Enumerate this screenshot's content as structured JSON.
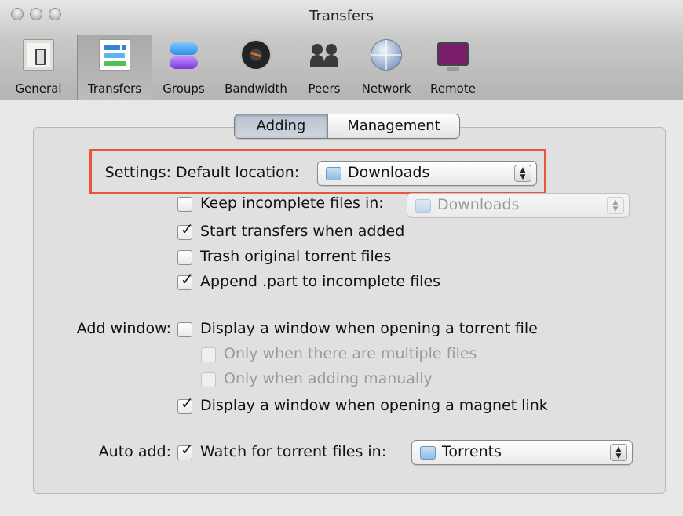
{
  "window": {
    "title": "Transfers"
  },
  "toolbar": {
    "items": [
      {
        "label": "General"
      },
      {
        "label": "Transfers"
      },
      {
        "label": "Groups"
      },
      {
        "label": "Bandwidth"
      },
      {
        "label": "Peers"
      },
      {
        "label": "Network"
      },
      {
        "label": "Remote"
      }
    ],
    "selected": "Transfers"
  },
  "tabs": [
    {
      "label": "Adding",
      "selected": true
    },
    {
      "label": "Management",
      "selected": false
    }
  ],
  "settings": {
    "label": "Settings:",
    "default_location_label": "Default location:",
    "default_location_value": "Downloads",
    "keep_incomplete": {
      "label": "Keep incomplete files in:",
      "checked": false,
      "value": "Downloads"
    },
    "start_transfers": {
      "label": "Start transfers when added",
      "checked": true
    },
    "trash_original": {
      "label": "Trash original torrent files",
      "checked": false
    },
    "append_part": {
      "label": "Append .part to incomplete files",
      "checked": true
    }
  },
  "add_window": {
    "label": "Add window:",
    "display_torrent": {
      "label": "Display a window when opening a torrent file",
      "checked": false
    },
    "only_multiple": {
      "label": "Only when there are multiple files",
      "checked": false
    },
    "only_manually": {
      "label": "Only when adding manually",
      "checked": false
    },
    "display_magnet": {
      "label": "Display a window when opening a magnet link",
      "checked": true
    }
  },
  "auto_add": {
    "label": "Auto add:",
    "watch": {
      "label": "Watch for torrent files in:",
      "checked": true,
      "value": "Torrents"
    }
  },
  "colors": {
    "highlight": "#e8553f",
    "selected_tab": "#c2cad5"
  }
}
